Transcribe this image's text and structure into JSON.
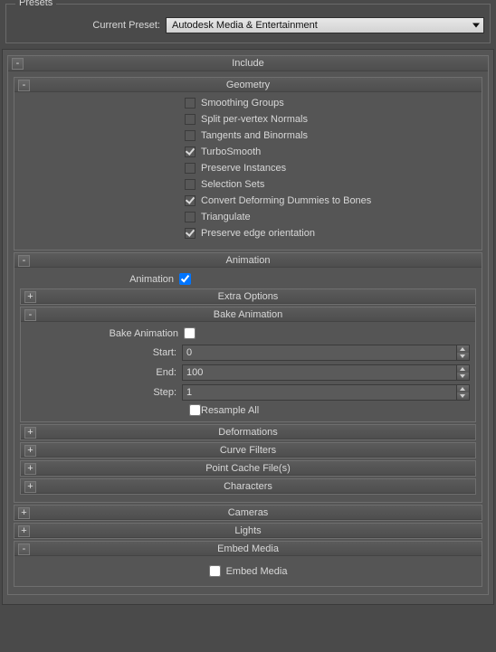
{
  "presets": {
    "legend": "Presets",
    "current_preset_label": "Current Preset:",
    "current_preset_value": "Autodesk Media & Entertainment"
  },
  "include": {
    "title": "Include",
    "geometry": {
      "title": "Geometry",
      "items": [
        {
          "label": "Smoothing Groups",
          "checked": false
        },
        {
          "label": "Split per-vertex Normals",
          "checked": false
        },
        {
          "label": "Tangents and Binormals",
          "checked": false
        },
        {
          "label": "TurboSmooth",
          "checked": true
        },
        {
          "label": "Preserve Instances",
          "checked": false
        },
        {
          "label": "Selection Sets",
          "checked": false
        },
        {
          "label": "Convert Deforming Dummies to Bones",
          "checked": true
        },
        {
          "label": "Triangulate",
          "checked": false
        },
        {
          "label": "Preserve edge orientation",
          "checked": true
        }
      ]
    },
    "animation": {
      "title": "Animation",
      "animation_label": "Animation",
      "animation_checked": true,
      "extra_options": {
        "title": "Extra Options"
      },
      "bake_animation": {
        "title": "Bake Animation",
        "bake_label": "Bake Animation",
        "bake_checked": false,
        "start_label": "Start:",
        "start_value": "0",
        "end_label": "End:",
        "end_value": "100",
        "step_label": "Step:",
        "step_value": "1",
        "resample_label": "Resample All",
        "resample_checked": false
      },
      "deformations": {
        "title": "Deformations"
      },
      "curve_filters": {
        "title": "Curve Filters"
      },
      "point_cache": {
        "title": "Point Cache File(s)"
      },
      "characters": {
        "title": "Characters"
      }
    },
    "cameras": {
      "title": "Cameras"
    },
    "lights": {
      "title": "Lights"
    },
    "embed_media": {
      "title": "Embed Media",
      "label": "Embed Media",
      "checked": false
    }
  }
}
